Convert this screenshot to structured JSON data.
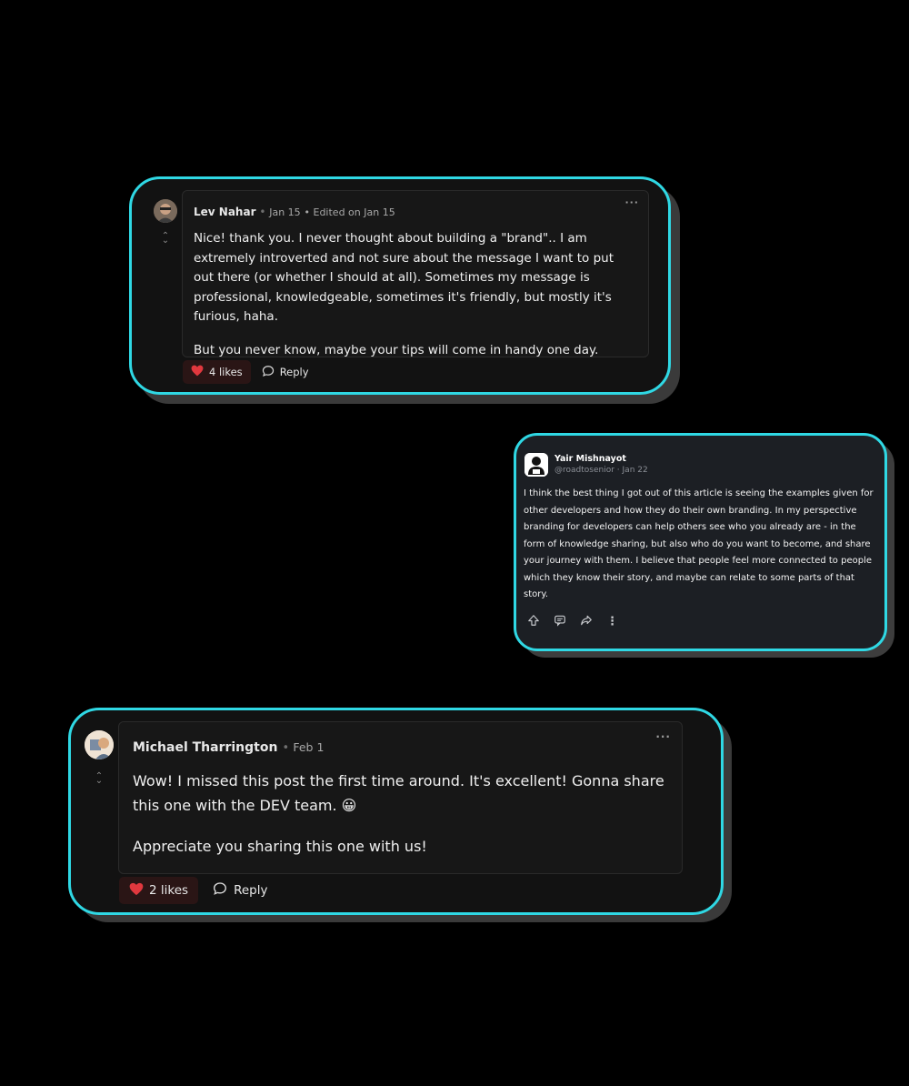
{
  "comment1": {
    "author": "Lev Nahar",
    "date": "Jan 15",
    "edited": "Edited on Jan 15",
    "paragraph1": "Nice! thank you. I never thought about building a \"brand\".. I am extremely introverted and not sure about the message I want to put out there (or whether I should at all). Sometimes my message is professional, knowledgeable, sometimes it's friendly, but mostly it's furious, haha.",
    "paragraph2": "But you never know, maybe your tips will come in handy one day.",
    "likes": "4 likes",
    "reply": "Reply",
    "more": "···"
  },
  "post2": {
    "author": "Yair Mishnayot",
    "handle": "@roadtosenior",
    "date": "Jan 22",
    "text": "I think the best thing I got out of this article is seeing the examples given for other developers and how they do their own branding. In my perspective branding for developers can help others see who you already are - in the form of knowledge sharing, but also who do you want to become, and share your journey with them. I believe that people feel more connected to people which they know their story, and maybe can relate to some parts of that story.",
    "more": "⋮"
  },
  "comment3": {
    "author": "Michael Tharrington",
    "date": "Feb 1",
    "paragraph1": "Wow! I missed this post the first time around. It's excellent! Gonna share this one with the DEV team. 😀",
    "paragraph2": "Appreciate you sharing this one with us!",
    "likes": "2 likes",
    "reply": "Reply",
    "more": "···"
  },
  "colors": {
    "border": "#2fd8e4",
    "heart": "#e0383e",
    "background": "#000000"
  }
}
